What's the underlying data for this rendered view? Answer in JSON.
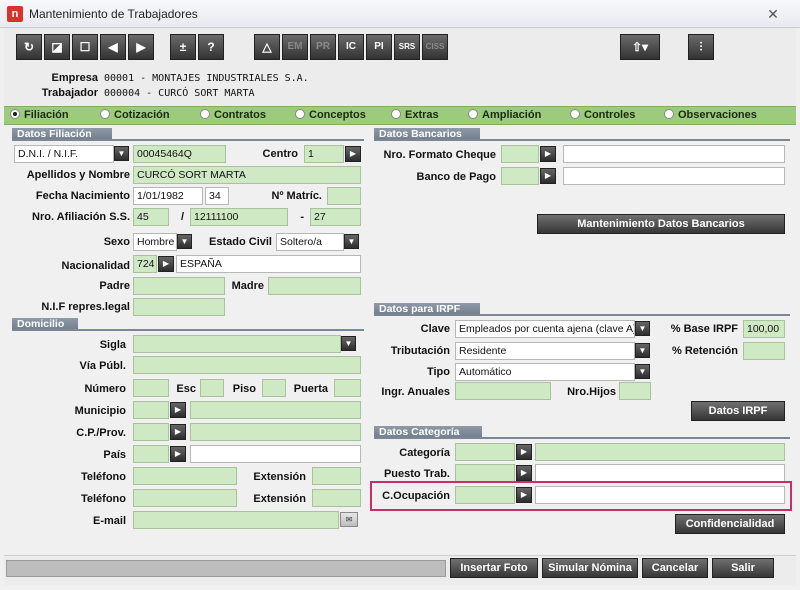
{
  "window": {
    "title": "Mantenimiento de Trabajadores",
    "app_icon": "n",
    "close": "✕"
  },
  "toolbar": {
    "refresh": "↻",
    "edit": "◪",
    "blank": "☐",
    "prev": "◀",
    "next": "▶",
    "plusminus": "±",
    "help": "?",
    "warn": "△",
    "em": "EM",
    "pr": "PR",
    "ic": "IC",
    "pi": "PI",
    "srs": "SRS",
    "ciss": "CISS",
    "nav": "⇧▾",
    "settings": "⫶"
  },
  "info": {
    "empresa_label": "Empresa",
    "empresa_value": "00001   -  MONTAJES INDUSTRIALES S.A.",
    "trabajador_label": "Trabajador",
    "trabajador_value": "000004  -  CURCÓ SORT MARTA"
  },
  "tabs": [
    "Filiación",
    "Cotización",
    "Contratos",
    "Conceptos",
    "Extras",
    "Ampliación",
    "Controles",
    "Observaciones"
  ],
  "sections": {
    "filiacion": "Datos Filiación",
    "domicilio": "Domicilio",
    "bancarios": "Datos Bancarios",
    "irpf": "Datos para IRPF",
    "categoria": "Datos Categoría"
  },
  "filiacion": {
    "doc_type": "D.N.I. / N.I.F.",
    "doc_value": "00045464Q",
    "centro_label": "Centro",
    "centro_value": "1",
    "nombre_label": "Apellidos y Nombre",
    "nombre_value": "CURCÓ SORT MARTA",
    "nac_label": "Fecha Nacimiento",
    "nac_value": "1/01/1982",
    "edad": "34",
    "matric_label": "Nº Matríc.",
    "matric_value": "",
    "ss_label": "Nro. Afiliación S.S.",
    "ss1": "45",
    "slash": "/",
    "ss2": "12111100",
    "dash": "-",
    "ss3": "27",
    "sexo_label": "Sexo",
    "sexo_value": "Hombre",
    "civil_label": "Estado Civil",
    "civil_value": "Soltero/a",
    "nacionalidad_label": "Nacionalidad",
    "nac_code": "724",
    "nac_country": "ESPAÑA",
    "padre_label": "Padre",
    "padre_value": "",
    "madre_label": "Madre",
    "madre_value": "",
    "repres_label": "N.I.F repres.legal",
    "repres_value": ""
  },
  "domicilio": {
    "sigla": "Sigla",
    "via": "Vía Públ.",
    "numero": "Número",
    "esc": "Esc",
    "piso": "Piso",
    "puerta": "Puerta",
    "municipio": "Municipio",
    "cp": "C.P./Prov.",
    "pais": "País",
    "telefono1": "Teléfono",
    "ext1": "Extensión",
    "telefono2": "Teléfono",
    "ext2": "Extensión",
    "email": "E-mail"
  },
  "bancarios": {
    "formato": "Nro. Formato Cheque",
    "banco": "Banco de Pago",
    "mantenimiento": "Mantenimiento Datos Bancarios"
  },
  "irpf": {
    "clave_label": "Clave",
    "clave_value": "Empleados por cuenta ajena (clave A)",
    "base_label": "% Base IRPF",
    "base_value": "100,00",
    "trib_label": "Tributación",
    "trib_value": "Residente",
    "ret_label": "% Retención",
    "ret_value": "",
    "tipo_label": "Tipo",
    "tipo_value": "Automático",
    "ingr_label": "Ingr. Anuales",
    "ingr_value": "",
    "hijos_label": "Nro.Hijos",
    "hijos_value": "",
    "datos_btn": "Datos IRPF"
  },
  "categoria": {
    "categoria": "Categoría",
    "puesto": "Puesto Trab.",
    "ocupacion": "C.Ocupación",
    "conf_btn": "Confidencialidad"
  },
  "footer": {
    "foto": "Insertar Foto",
    "simular": "Simular Nómina",
    "cancelar": "Cancelar",
    "salir": "Salir"
  },
  "colors": {
    "field": "#cfe9c4",
    "tabs": "#9ccb7b",
    "section": "#7c8796",
    "highlight": "#c4306a"
  }
}
